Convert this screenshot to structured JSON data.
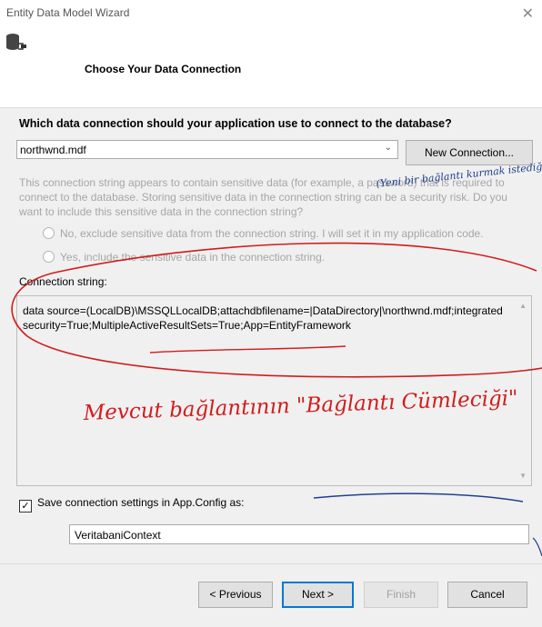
{
  "window": {
    "title": "Entity Data Model Wizard",
    "close_glyph": "✕"
  },
  "header": {
    "page_title": "Choose Your Data Connection"
  },
  "question": "Which data connection should your application use to connect to the database?",
  "connection_select": {
    "selected": "northwnd.mdf",
    "chevron": "⌄"
  },
  "new_connection_label": "New Connection...",
  "sensitive_text": "This connection string appears to contain sensitive data (for example, a password) that is required to connect to the database. Storing sensitive data in the connection string can be a security risk. Do you want to include this sensitive data in the connection string?",
  "radio_options": [
    "No, exclude sensitive data from the connection string. I will set it in my application code.",
    "Yes, include the sensitive data in the connection string."
  ],
  "connection_string_label": "Connection string:",
  "connection_string": "data source=(LocalDB)\\MSSQLLocalDB;attachdbfilename=|DataDirectory|\\northwnd.mdf;integrated security=True;MultipleActiveResultSets=True;App=EntityFramework",
  "save_settings": {
    "checked": true,
    "check_glyph": "✓",
    "label": "Save connection settings in App.Config as:"
  },
  "context_name": "VeritabaniContext",
  "buttons": {
    "previous": "< Previous",
    "next": "Next >",
    "finish": "Finish",
    "cancel": "Cancel"
  },
  "handwriting": {
    "note_top": "(Yeni bir bağlantı kurmak istediğimizde -)",
    "note_main": "Mevcut bağlantının \"Bağlantı Cümleciği\""
  },
  "colors": {
    "ink_red": "#d11c1c",
    "ink_blue": "#1f3f8f",
    "accent": "#0078d7"
  }
}
